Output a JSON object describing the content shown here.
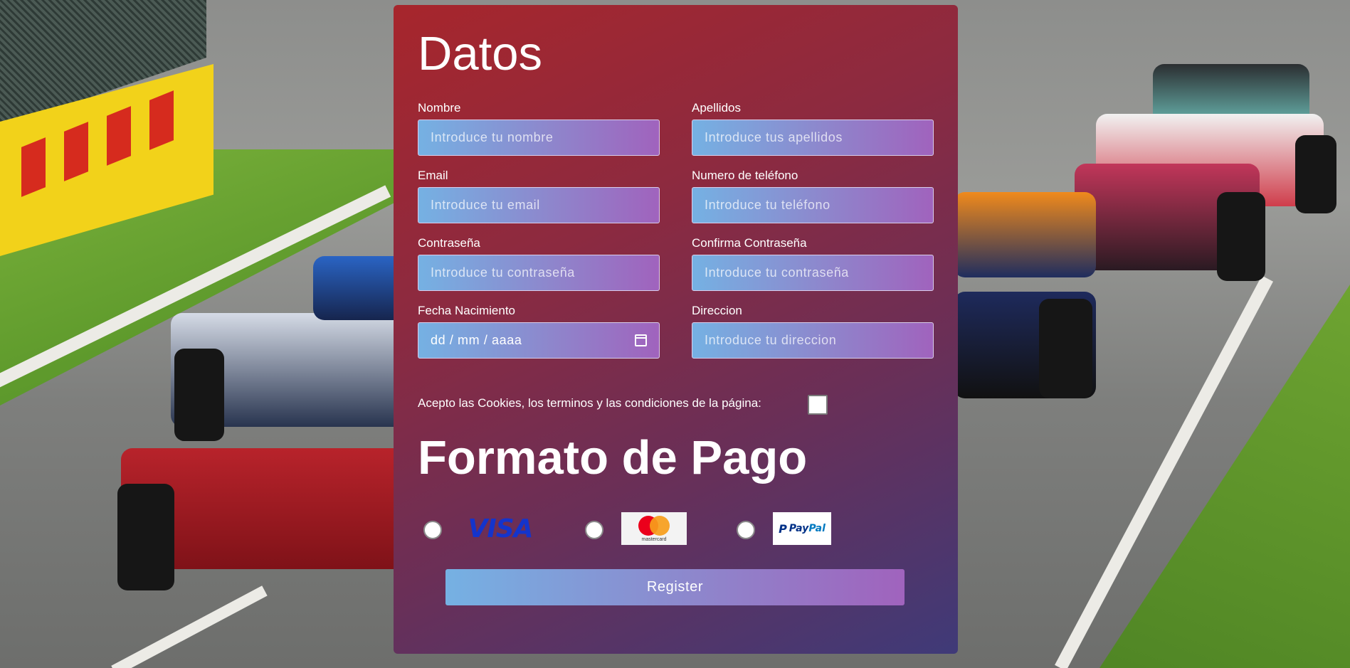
{
  "form": {
    "title": "Datos",
    "fields": [
      {
        "label": "Nombre",
        "placeholder": "Introduce tu nombre"
      },
      {
        "label": "Apellidos",
        "placeholder": "Introduce tus apellidos"
      },
      {
        "label": "Email",
        "placeholder": "Introduce tu email"
      },
      {
        "label": "Numero de teléfono",
        "placeholder": "Introduce tu teléfono"
      },
      {
        "label": "Contraseña",
        "placeholder": "Introduce tu contraseña"
      },
      {
        "label": "Confirma Contraseña",
        "placeholder": "Introduce tu contraseña"
      },
      {
        "label": "Fecha Nacimiento",
        "placeholder": "dd / mm / aaaa"
      },
      {
        "label": "Direccion",
        "placeholder": "Introduce tu direccion"
      }
    ],
    "terms_label": "Acepto las Cookies, los terminos y las condiciones de la página:",
    "terms_checked": false
  },
  "payment": {
    "title": "Formato de Pago",
    "methods": [
      {
        "name": "VISA",
        "selected": false
      },
      {
        "name": "mastercard",
        "selected": false
      },
      {
        "name": "PayPal",
        "selected": false
      }
    ],
    "visa_text": "VISA",
    "mastercard_text": "mastercard",
    "paypal_text_a": "Pay",
    "paypal_text_b": "Pal"
  },
  "register_label": "Register",
  "colors": {
    "panel_top": "#a7262c",
    "panel_bottom": "#3f3a78",
    "input_gradient_start": "#75b1e3",
    "input_gradient_end": "#a063bd"
  }
}
